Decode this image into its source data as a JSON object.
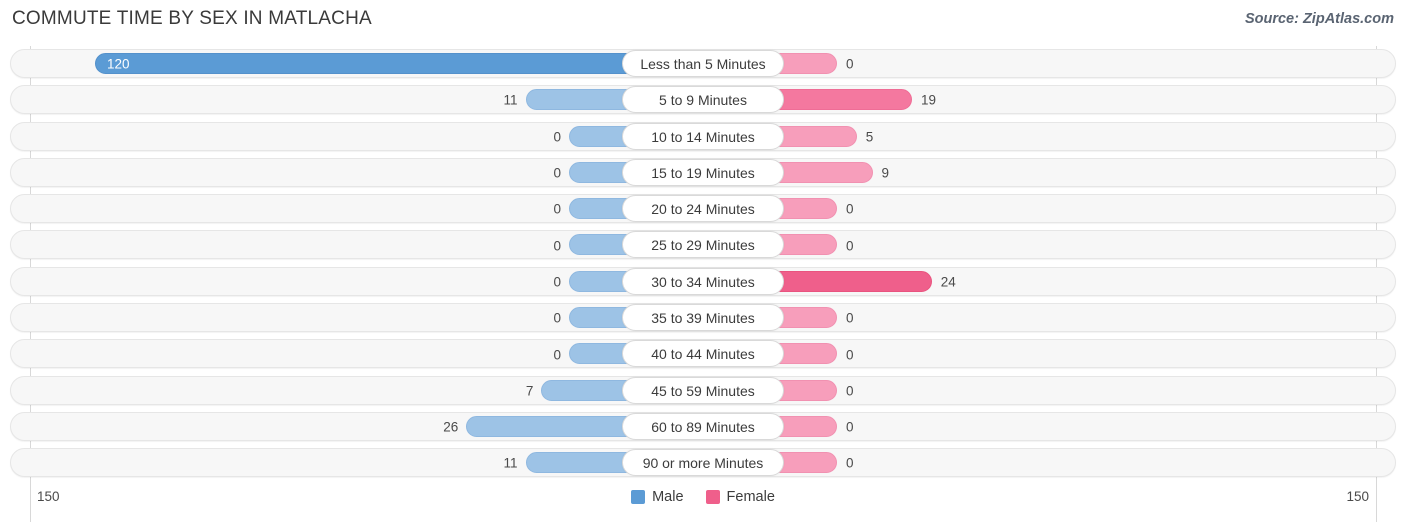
{
  "header": {
    "title": "COMMUTE TIME BY SEX IN MATLACHA",
    "source": "Source: ZipAtlas.com"
  },
  "axis": {
    "left_label": "150",
    "right_label": "150",
    "max": 150
  },
  "legend": {
    "items": [
      {
        "label": "Male",
        "color": "#5b9bd5"
      },
      {
        "label": "Female",
        "color": "#ef5f8b"
      }
    ]
  },
  "chart_data": {
    "type": "bar",
    "orientation": "horizontal-diverging",
    "title": "COMMUTE TIME BY SEX IN MATLACHA",
    "xlabel": "",
    "ylabel": "",
    "xlim": [
      150,
      150
    ],
    "grid": true,
    "legend_position": "bottom-center",
    "categories": [
      "Less than 5 Minutes",
      "5 to 9 Minutes",
      "10 to 14 Minutes",
      "15 to 19 Minutes",
      "20 to 24 Minutes",
      "25 to 29 Minutes",
      "30 to 34 Minutes",
      "35 to 39 Minutes",
      "40 to 44 Minutes",
      "45 to 59 Minutes",
      "60 to 89 Minutes",
      "90 or more Minutes"
    ],
    "series": [
      {
        "name": "Male",
        "color": "#5b9bd5",
        "values": [
          120,
          11,
          0,
          0,
          0,
          0,
          0,
          0,
          0,
          7,
          26,
          11
        ]
      },
      {
        "name": "Female",
        "color": "#ef5f8b",
        "values": [
          0,
          19,
          5,
          9,
          0,
          0,
          24,
          0,
          0,
          0,
          0,
          0
        ]
      }
    ]
  },
  "rows": [
    {
      "category": "Less than 5 Minutes",
      "male": "120",
      "female": "0"
    },
    {
      "category": "5 to 9 Minutes",
      "male": "11",
      "female": "19"
    },
    {
      "category": "10 to 14 Minutes",
      "male": "0",
      "female": "5"
    },
    {
      "category": "15 to 19 Minutes",
      "male": "0",
      "female": "9"
    },
    {
      "category": "20 to 24 Minutes",
      "male": "0",
      "female": "0"
    },
    {
      "category": "25 to 29 Minutes",
      "male": "0",
      "female": "0"
    },
    {
      "category": "30 to 34 Minutes",
      "male": "0",
      "female": "24"
    },
    {
      "category": "35 to 39 Minutes",
      "male": "0",
      "female": "0"
    },
    {
      "category": "40 to 44 Minutes",
      "male": "0",
      "female": "0"
    },
    {
      "category": "45 to 59 Minutes",
      "male": "7",
      "female": "0"
    },
    {
      "category": "60 to 89 Minutes",
      "male": "26",
      "female": "0"
    },
    {
      "category": "90 or more Minutes",
      "male": "11",
      "female": "0"
    }
  ]
}
